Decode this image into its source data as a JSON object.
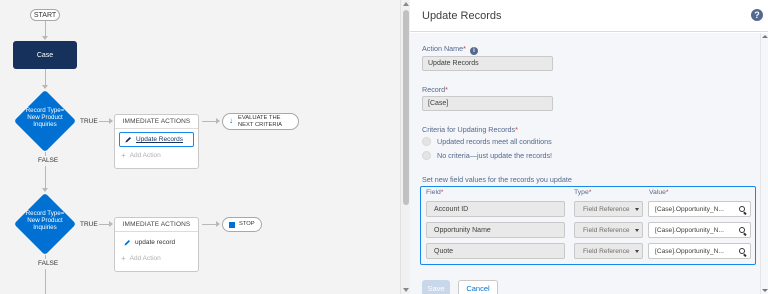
{
  "canvas": {
    "start_label": "START",
    "object_label": "Case",
    "nodes": [
      {
        "criteria": [
          "Record Type=",
          "New Product",
          "Inquiries"
        ],
        "true_label": "TRUE",
        "false_label": "FALSE",
        "actions_header": "IMMEDIATE ACTIONS",
        "action_label": "Update Records",
        "add_action_label": "Add Action",
        "next_label_line1": "EVALUATE THE",
        "next_label_line2": "NEXT CRITERIA"
      },
      {
        "criteria": [
          "Record Type=",
          "New Product",
          "Inquiries"
        ],
        "true_label": "TRUE",
        "false_label": "FALSE",
        "actions_header": "IMMEDIATE ACTIONS",
        "action_label": "update record",
        "add_action_label": "Add Action",
        "next_label": "STOP"
      }
    ]
  },
  "panel": {
    "title": "Update Records",
    "help_glyph": "?",
    "action_name_label": "Action Name",
    "action_name_value": "Update Records",
    "record_label": "Record",
    "record_value": "[Case]",
    "criteria_label": "Criteria for Updating Records",
    "criteria_options": [
      "Updated records meet all conditions",
      "No criteria—just update the records!"
    ],
    "set_values_label": "Set new field values for the records you update",
    "columns": {
      "field": "Field",
      "type": "Type",
      "value": "Value"
    },
    "rows": [
      {
        "field": "Account ID",
        "type": "Field Reference",
        "value": "[Case].Opportunity_N..."
      },
      {
        "field": "Opportunity Name",
        "type": "Field Reference",
        "value": "[Case].Opportunity_N..."
      },
      {
        "field": "Quote",
        "type": "Field Reference",
        "value": "[Case].Opportunity_N..."
      }
    ],
    "save_label": "Save",
    "cancel_label": "Cancel",
    "required_mark": "*"
  },
  "colors": {
    "object_box": "#16325c",
    "diamond": "#0070d2",
    "selected_border": "#1589ee"
  }
}
